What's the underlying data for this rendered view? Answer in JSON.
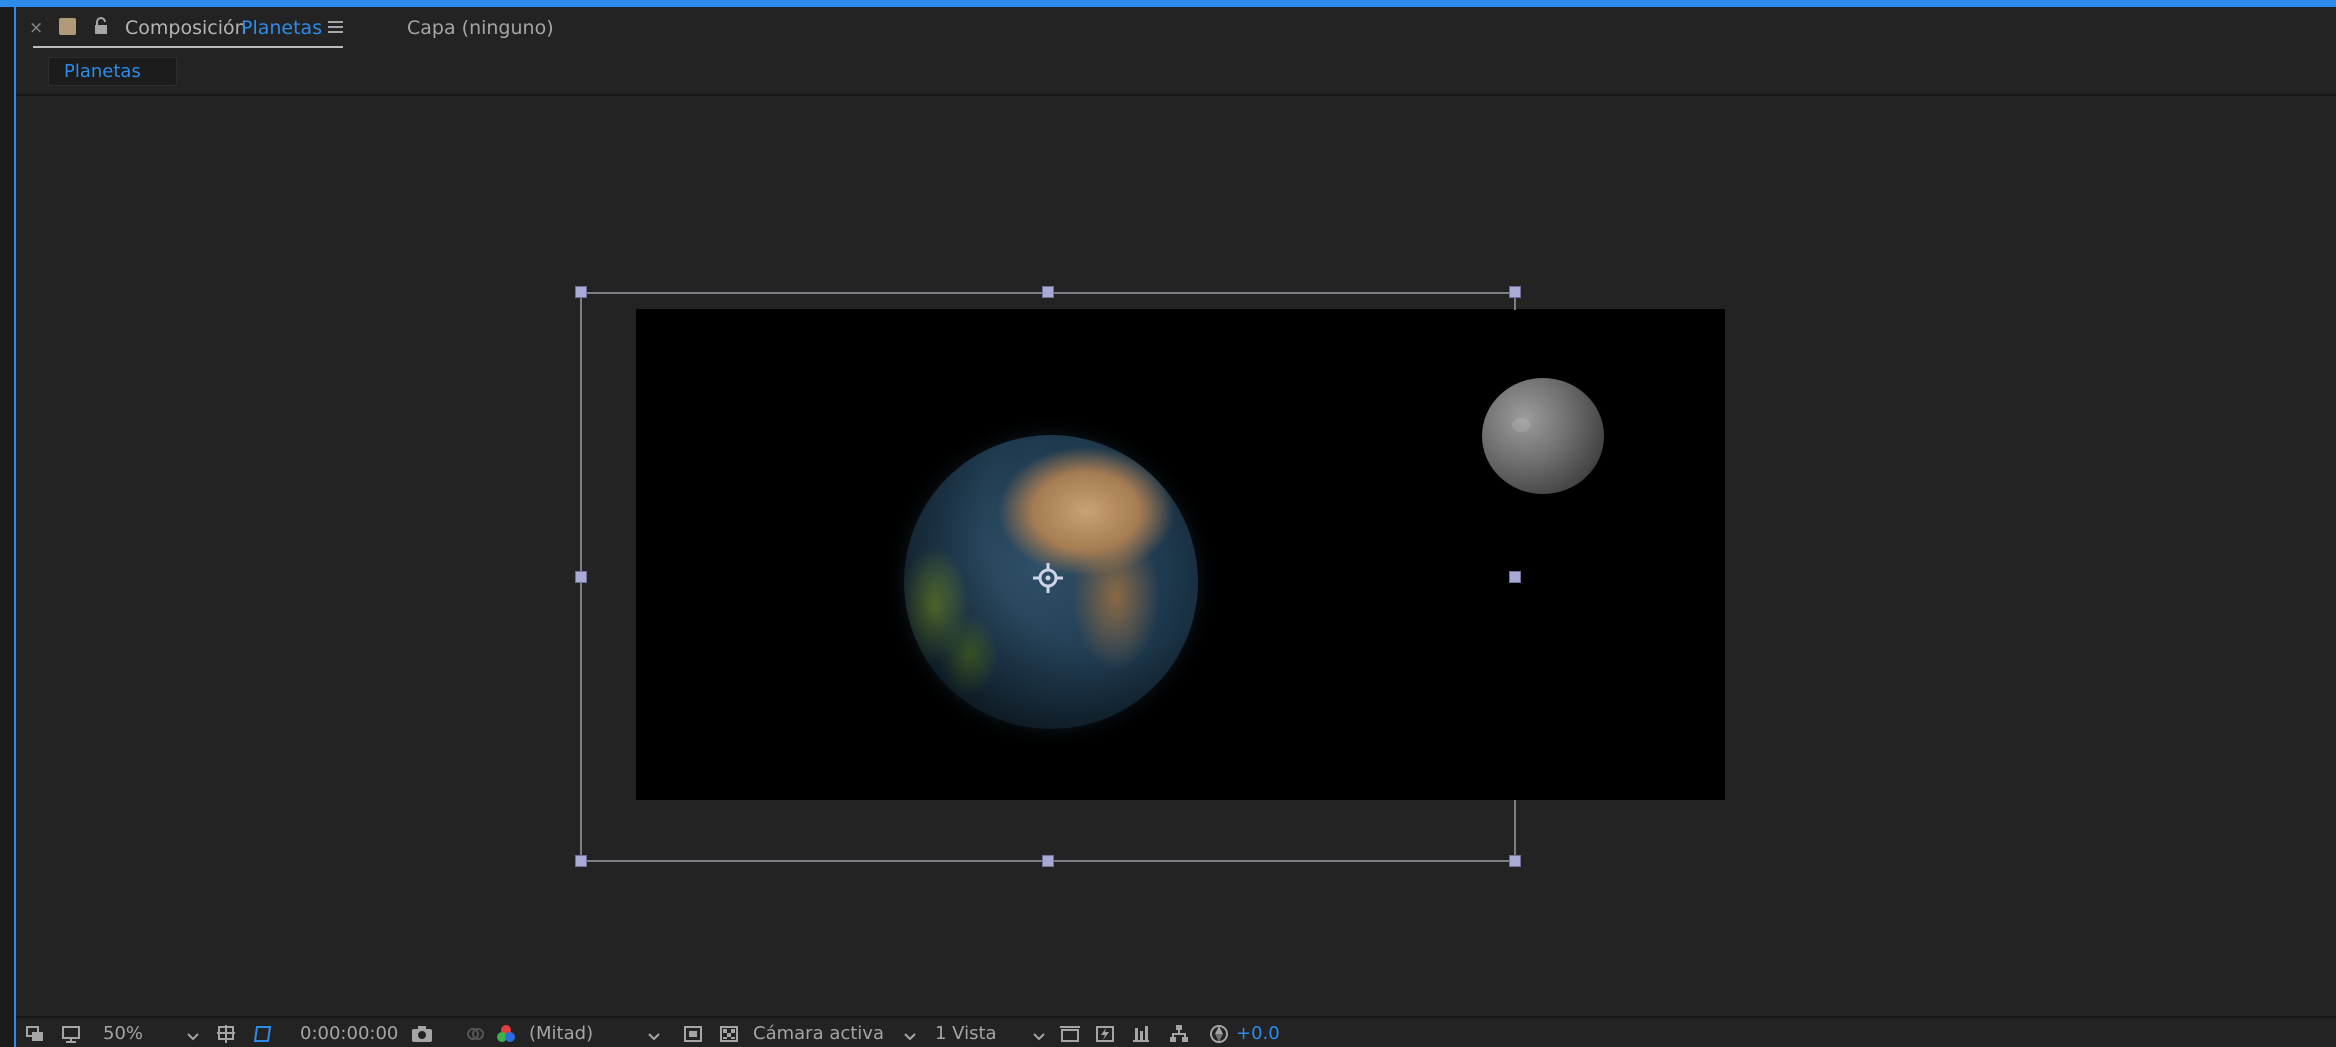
{
  "panel": {
    "tab_label": "Composición",
    "comp_name": "Planetas",
    "layer_tab": "Capa  (ninguno)",
    "breadcrumb": "Planetas"
  },
  "viewer": {
    "canvas_objects": [
      "earth",
      "moon"
    ],
    "colors": {
      "accent": "#2d8ceb",
      "handle": "#a9abd6",
      "background": "#232323"
    }
  },
  "toolbar": {
    "zoom": "50%",
    "timecode": "0:00:00:00",
    "resolution": "(Mitad)",
    "camera": "Cámara activa",
    "views": "1 Vista",
    "exposure": "+0.0"
  },
  "icons": [
    "close-icon",
    "label-color-swatch",
    "lock-icon",
    "panel-menu-icon",
    "always-preview-icon",
    "monitor-icon",
    "grid-guides-icon",
    "mask-visibility-icon",
    "snapshot-icon",
    "show-snapshot-icon",
    "channel-icon",
    "region-of-interest-icon",
    "transparency-grid-icon",
    "pixel-aspect-icon",
    "fast-preview-icon",
    "timeline-icon",
    "flowchart-icon",
    "exposure-reset-icon",
    "anchor-point-icon"
  ]
}
